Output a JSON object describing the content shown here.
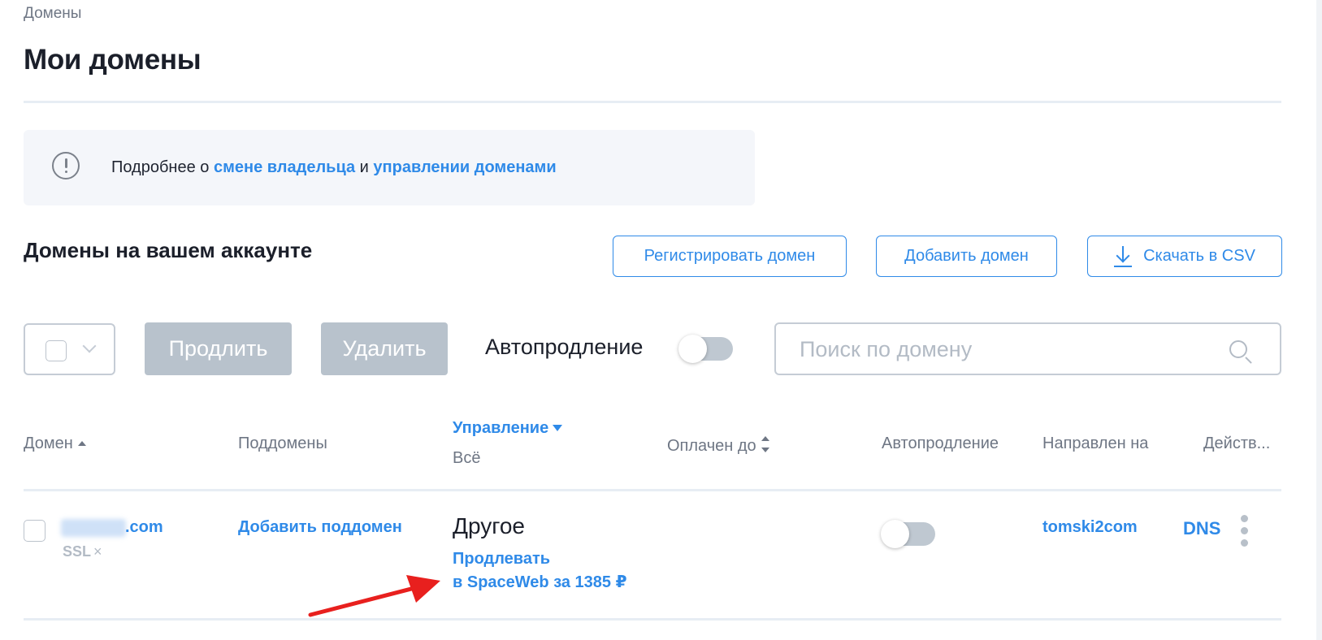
{
  "breadcrumb": "Домены",
  "page_title": "Мои домены",
  "info": {
    "prefix": "Подробнее о ",
    "link_owner": "смене владельца",
    "middle": " и ",
    "link_manage": "управлении доменами"
  },
  "section_title": "Домены на вашем аккаунте",
  "actions": {
    "register": "Регистрировать домен",
    "add": "Добавить домен",
    "csv": "Скачать в CSV"
  },
  "toolbar": {
    "extend": "Продлить",
    "delete": "Удалить",
    "autorenew": "Автопродление",
    "search_placeholder": "Поиск по домену"
  },
  "table": {
    "headers": {
      "domain": "Домен",
      "subdomains": "Поддомены",
      "management": "Управление",
      "management_filter": "Всё",
      "paid_until": "Оплачен до",
      "autorenew": "Автопродление",
      "directed_to": "Направлен на",
      "actions": "Действ..."
    },
    "rows": [
      {
        "domain_suffix": ".com",
        "ssl": "SSL",
        "ssl_x": "×",
        "add_subdomain": "Добавить поддомен",
        "management": "Другое",
        "renew_line1": "Продлевать",
        "renew_line2": "в SpaceWeb за 1385 ₽",
        "paid_until": "",
        "directed_to": "tomski2com",
        "dns": "DNS"
      }
    ]
  },
  "colors": {
    "accent": "#2f8ae8",
    "arrow": "#e8201e",
    "disabled_button": "#b8c2cc"
  }
}
